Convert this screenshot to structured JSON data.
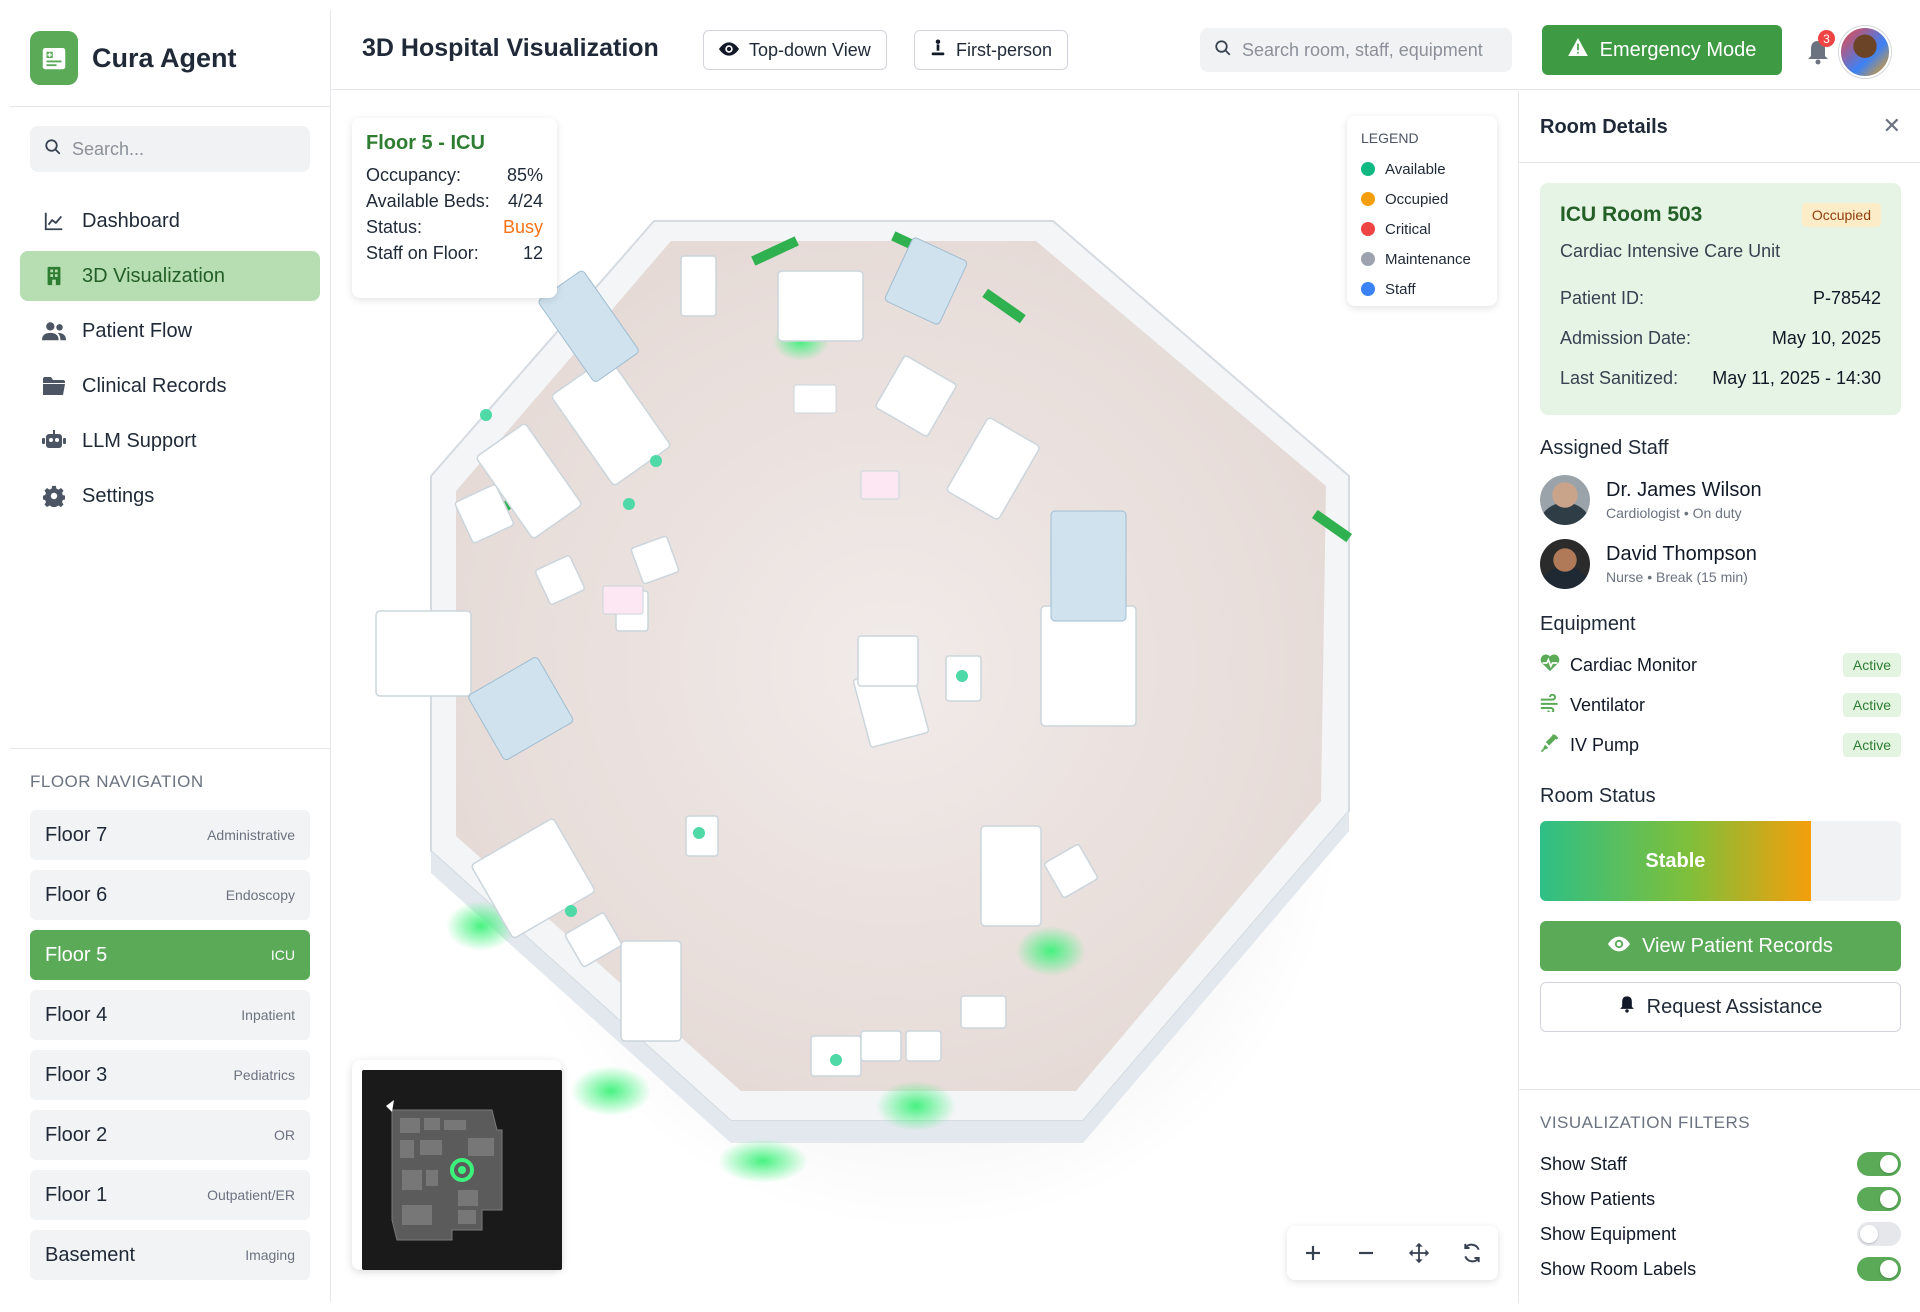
{
  "app": {
    "name": "Cura Agent"
  },
  "sidebar": {
    "search_placeholder": "Search...",
    "nav": [
      {
        "label": "Dashboard",
        "icon": "chart-line-icon"
      },
      {
        "label": "3D Visualization",
        "icon": "building-icon",
        "active": true
      },
      {
        "label": "Patient Flow",
        "icon": "users-icon"
      },
      {
        "label": "Clinical Records",
        "icon": "folder-icon"
      },
      {
        "label": "LLM Support",
        "icon": "robot-icon"
      },
      {
        "label": "Settings",
        "icon": "gear-icon"
      }
    ],
    "floor_nav_title": "FLOOR NAVIGATION",
    "floors": [
      {
        "name": "Floor 7",
        "type": "Administrative"
      },
      {
        "name": "Floor 6",
        "type": "Endoscopy"
      },
      {
        "name": "Floor 5",
        "type": "ICU",
        "active": true
      },
      {
        "name": "Floor 4",
        "type": "Inpatient"
      },
      {
        "name": "Floor 3",
        "type": "Pediatrics"
      },
      {
        "name": "Floor 2",
        "type": "OR"
      },
      {
        "name": "Floor 1",
        "type": "Outpatient/ER"
      },
      {
        "name": "Basement",
        "type": "Imaging"
      }
    ]
  },
  "header": {
    "title": "3D Hospital Visualization",
    "topdown_label": "Top-down View",
    "firstperson_label": "First-person",
    "search_placeholder": "Search room, staff, equipment",
    "emergency_label": "Emergency Mode",
    "notification_count": "3"
  },
  "floor_info": {
    "title": "Floor 5 - ICU",
    "rows": [
      {
        "label": "Occupancy:",
        "value": "85%"
      },
      {
        "label": "Available Beds:",
        "value": "4/24"
      },
      {
        "label": "Status:",
        "value": "Busy"
      },
      {
        "label": "Staff on Floor:",
        "value": "12"
      }
    ]
  },
  "legend": {
    "title": "LEGEND",
    "items": [
      {
        "label": "Available",
        "color": "#10b981"
      },
      {
        "label": "Occupied",
        "color": "#f59e0b"
      },
      {
        "label": "Critical",
        "color": "#ef4444"
      },
      {
        "label": "Maintenance",
        "color": "#9ca3af"
      },
      {
        "label": "Staff",
        "color": "#3b82f6"
      }
    ]
  },
  "zoom_controls": [
    "zoom-in-icon",
    "zoom-out-icon",
    "pan-icon",
    "reset-view-icon"
  ],
  "room_panel": {
    "title": "Room Details",
    "room": {
      "name": "ICU Room 503",
      "status": "Occupied",
      "unit": "Cardiac Intensive Care Unit",
      "rows": [
        {
          "label": "Patient ID:",
          "value": "P-78542"
        },
        {
          "label": "Admission Date:",
          "value": "May 10, 2025"
        },
        {
          "label": "Last Sanitized:",
          "value": "May 11, 2025 - 14:30"
        }
      ]
    },
    "staff_title": "Assigned Staff",
    "staff": [
      {
        "name": "Dr. James Wilson",
        "role": "Cardiologist • On duty"
      },
      {
        "name": "David Thompson",
        "role": "Nurse • Break (15 min)"
      }
    ],
    "equipment_title": "Equipment",
    "equipment": [
      {
        "name": "Cardiac Monitor",
        "status": "Active",
        "icon": "heart-pulse-icon"
      },
      {
        "name": "Ventilator",
        "status": "Active",
        "icon": "wind-icon"
      },
      {
        "name": "IV Pump",
        "status": "Active",
        "icon": "syringe-icon"
      }
    ],
    "room_status_title": "Room Status",
    "room_status": {
      "label": "Stable",
      "level_percent": 75
    },
    "view_records_label": "View Patient Records",
    "request_assistance_label": "Request Assistance",
    "filters_title": "VISUALIZATION FILTERS",
    "filters": [
      {
        "label": "Show Staff",
        "on": true
      },
      {
        "label": "Show Patients",
        "on": true
      },
      {
        "label": "Show Equipment",
        "on": false
      },
      {
        "label": "Show Room Labels",
        "on": true
      }
    ]
  },
  "colors": {
    "brand": "#5aaa58",
    "brand_dark": "#2e7d32",
    "busy": "#f97316",
    "alert": "#ef4444"
  }
}
